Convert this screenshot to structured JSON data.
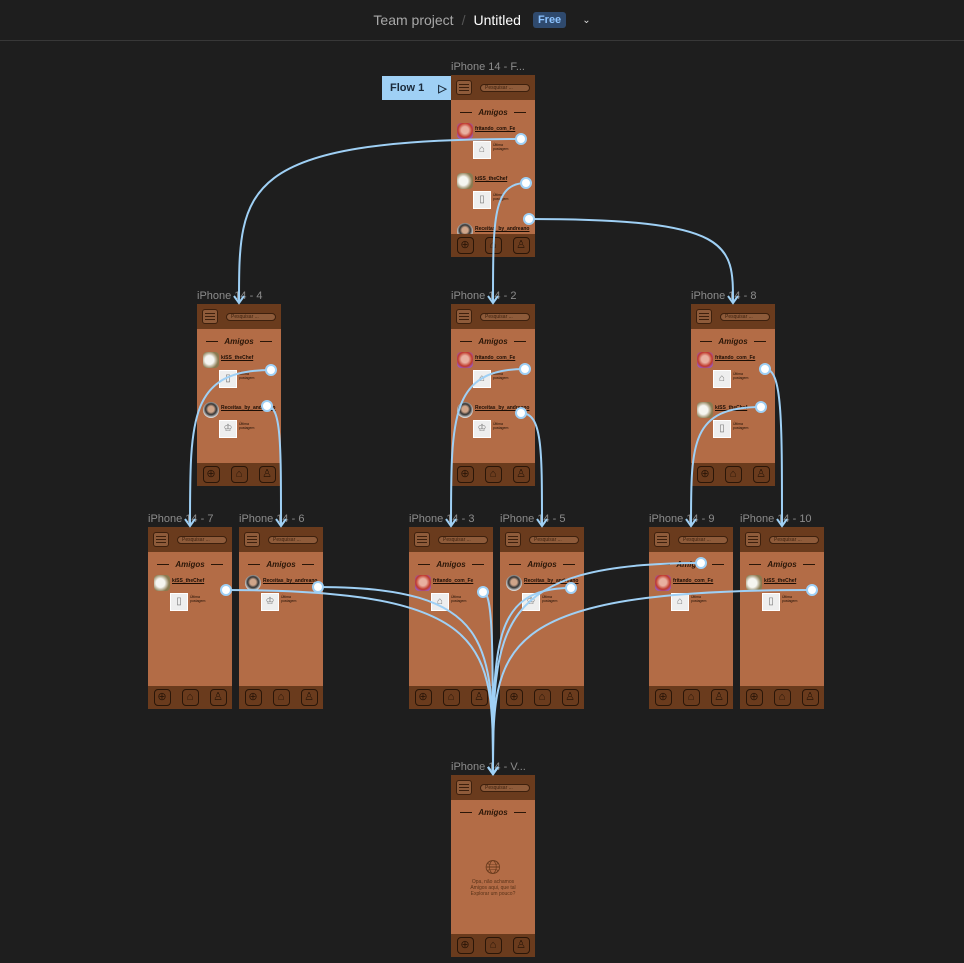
{
  "header": {
    "team": "Team project",
    "separator": "/",
    "file": "Untitled",
    "plan_badge": "Free"
  },
  "flow": {
    "label": "Flow 1"
  },
  "common": {
    "search_placeholder": "Pesquisar ...",
    "section_title": "Amigos",
    "last_post": "Última postagem"
  },
  "friends": {
    "fritando": {
      "name": "fritando_com_Fe",
      "avatar": "woman",
      "thumb_icon": "cake-icon"
    },
    "kiss": {
      "name": "kiSS_theChef",
      "avatar": "chef",
      "thumb_icon": "drink-icon"
    },
    "receitas": {
      "name": "Receitas_by_andreano",
      "avatar": "man",
      "thumb_icon": "chef-hat-icon"
    }
  },
  "frames": [
    {
      "id": "F",
      "title": "iPhone 14 - F...",
      "friends": [
        "fritando",
        "kiss",
        "receitas"
      ]
    },
    {
      "id": "4",
      "title": "iPhone 14 - 4",
      "friends": [
        "kiss",
        "receitas"
      ]
    },
    {
      "id": "2",
      "title": "iPhone 14 - 2",
      "friends": [
        "fritando",
        "receitas"
      ]
    },
    {
      "id": "8",
      "title": "iPhone 14 - 8",
      "friends": [
        "fritando",
        "kiss"
      ]
    },
    {
      "id": "7",
      "title": "iPhone 14 - 7",
      "friends": [
        "kiss"
      ]
    },
    {
      "id": "6",
      "title": "iPhone 14 - 6",
      "friends": [
        "receitas"
      ]
    },
    {
      "id": "3",
      "title": "iPhone 14 - 3",
      "friends": [
        "fritando"
      ]
    },
    {
      "id": "5",
      "title": "iPhone 14 - 5",
      "friends": [
        "receitas"
      ]
    },
    {
      "id": "9",
      "title": "iPhone 14 - 9",
      "friends": [
        "fritando"
      ]
    },
    {
      "id": "10",
      "title": "iPhone 14 - 10",
      "friends": [
        "kiss"
      ]
    },
    {
      "id": "V",
      "title": "iPhone 14 - V...",
      "friends": [],
      "empty_message": "Opa, não achamos Amigos aqui, que tal Explorar um pouco?"
    }
  ],
  "colors": {
    "wire": "#9fd0f5",
    "frame_body": "#b36c46",
    "frame_bar": "#6a3b1d"
  }
}
